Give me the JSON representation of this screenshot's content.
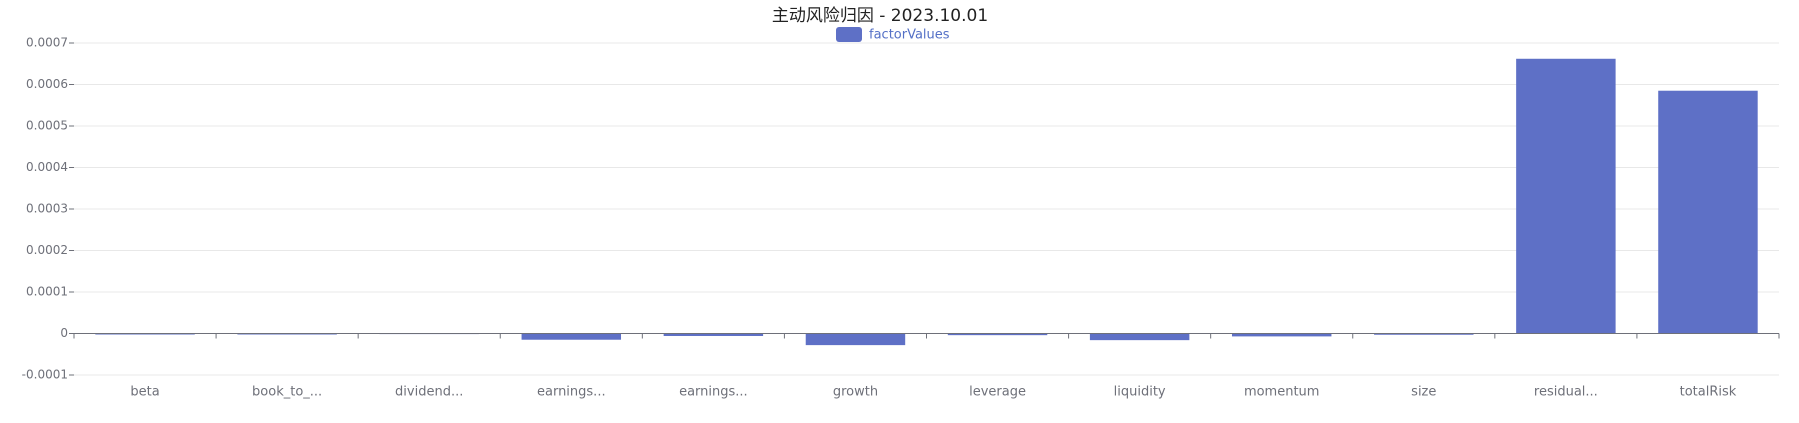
{
  "chart_data": {
    "type": "bar",
    "title": "主动风险归因 - 2023.10.01",
    "categories": [
      "beta",
      "book_to_...",
      "dividend...",
      "earnings...",
      "earnings...",
      "growth",
      "leverage",
      "liquidity",
      "momentum",
      "size",
      "residual...",
      "totalRisk"
    ],
    "series": [
      {
        "name": "factorValues",
        "values": [
          -2e-06,
          0.0,
          1e-06,
          -1.5e-05,
          -6e-06,
          -2.8e-05,
          -4e-06,
          -1.6e-05,
          -7e-06,
          -3e-06,
          0.000662,
          0.000585
        ]
      }
    ],
    "ylim": [
      -0.0001,
      0.0007
    ],
    "yticks": [
      -0.0001,
      0,
      0.0001,
      0.0002,
      0.0003,
      0.0004,
      0.0005,
      0.0006,
      0.0007
    ],
    "ytick_labels": [
      "-0.0001",
      "0",
      "0.0001",
      "0.0002",
      "0.0003",
      "0.0004",
      "0.0005",
      "0.0006",
      "0.0007"
    ],
    "xlabel": "",
    "ylabel": "",
    "legend_position": "top-center",
    "grid": true,
    "colors": {
      "bar": "#5e70c6",
      "legend_text": "#5470c6",
      "grid": "#e8e8e8",
      "axis": "#6e7079"
    }
  }
}
